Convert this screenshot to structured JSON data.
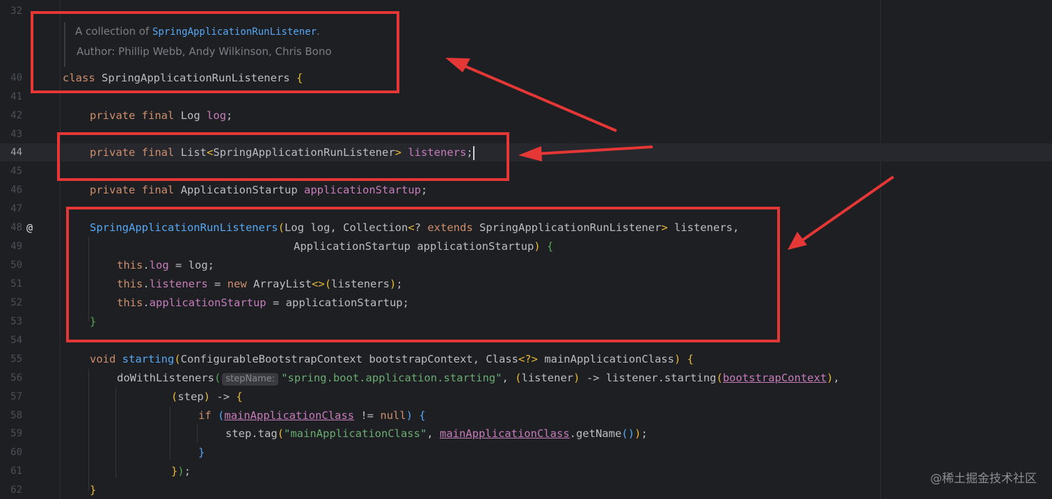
{
  "editor": {
    "line_numbers": [
      "32",
      "40",
      "41",
      "42",
      "43",
      "44",
      "45",
      "46",
      "47",
      "48",
      "49",
      "50",
      "51",
      "52",
      "53",
      "54",
      "55",
      "56",
      "57",
      "58",
      "59",
      "60",
      "61",
      "62"
    ],
    "current_line": "44",
    "gutter_marker": "@",
    "doc_comment": {
      "prefix": "A collection of ",
      "link": "SpringApplicationRunListener",
      "suffix": ".",
      "author_line": "Author: Phillip Webb, Andy Wilkinson, Chris Bono"
    },
    "inlay_hint": "stepName:",
    "tokens": {
      "class_kw": "class",
      "class_name": "SpringApplicationRunListeners",
      "open_brace": "{",
      "close_brace": "}",
      "private": "private",
      "final": "final",
      "log_type": "Log",
      "log_field": "log",
      "list_type": "List",
      "listener_type": "SpringApplicationRunListener",
      "listeners_field": "listeners",
      "startup_type": "ApplicationStartup",
      "startup_field": "applicationStartup",
      "ctor_name": "SpringApplicationRunListeners",
      "collection_type": "Collection",
      "q_extends": "?",
      "extends_kw": "extends",
      "this_kw": "this",
      "new_kw": "new",
      "arraylist": "ArrayList",
      "void_kw": "void",
      "starting_fn": "starting",
      "bootstrap_type": "ConfigurableBootstrapContext",
      "bootstrap_param": "bootstrapContext",
      "class_type": "Class",
      "generic_q": "<?>",
      "main_param": "mainApplicationClass",
      "dowith": "doWithListeners",
      "str_starting": "\"spring.boot.application.starting\"",
      "listener_param": "listener",
      "arrow": "->",
      "step_param": "step",
      "if_kw": "if",
      "null_kw": "null",
      "neq": "!=",
      "tag_call": "step.tag",
      "str_main": "\"mainApplicationClass\"",
      "get_name": "getName",
      "diamond": "<>"
    }
  },
  "watermark": "@稀土掘金技术社区",
  "colors": {
    "background": "#1e1f22",
    "keyword": "#cf8e6d",
    "field": "#c77dbb",
    "function": "#56a8f5",
    "string": "#6aab73",
    "annotation_box": "#e63737"
  }
}
